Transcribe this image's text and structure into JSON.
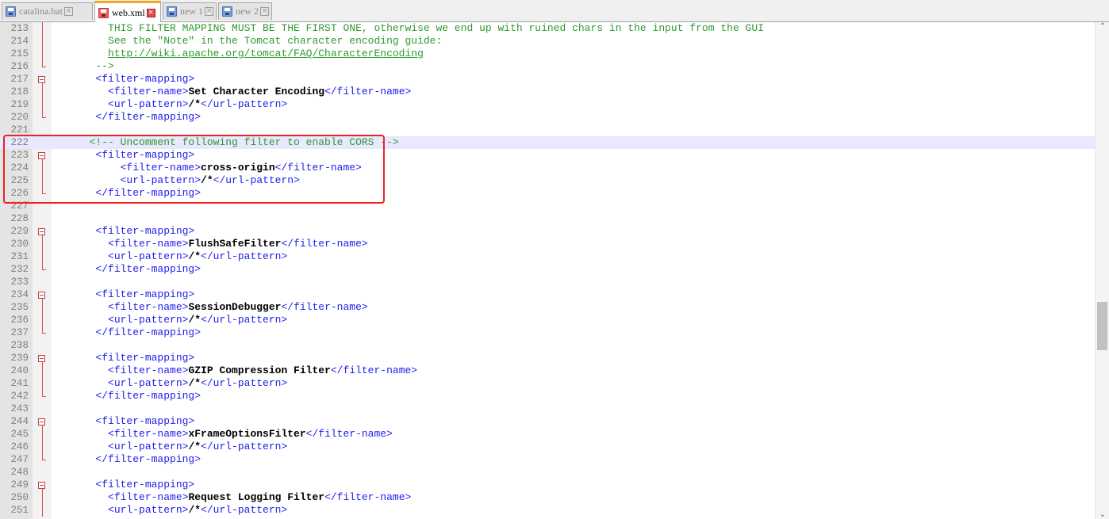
{
  "tabs": [
    {
      "label": "catalina.bat",
      "active": false,
      "icon": "save-disk-icon"
    },
    {
      "label": "web.xml",
      "active": true,
      "icon": "unsaved-disk-icon"
    },
    {
      "label": "new 1",
      "active": false,
      "icon": "save-disk-icon"
    },
    {
      "label": "new 2",
      "active": false,
      "icon": "save-disk-icon"
    }
  ],
  "tab_close_glyph": "×",
  "editor": {
    "lines": [
      {
        "num": "213",
        "segs": [
          {
            "t": "          THIS FILTER MAPPING MUST BE THE FIRST ONE, otherwise we end up with ruined chars in the input from the GUI",
            "c": "cm"
          }
        ]
      },
      {
        "num": "214",
        "segs": [
          {
            "t": "          See the \"Note\" in the Tomcat character encoding guide:",
            "c": "cm"
          }
        ]
      },
      {
        "num": "215",
        "segs": [
          {
            "t": "          ",
            "c": "cm"
          },
          {
            "t": "http://wiki.apache.org/tomcat/FAQ/CharacterEncoding",
            "c": "cm link"
          }
        ]
      },
      {
        "num": "216",
        "segs": [
          {
            "t": "        -->",
            "c": "cm"
          }
        ]
      },
      {
        "num": "217",
        "segs": [
          {
            "t": "        ",
            "c": "tg"
          },
          {
            "t": "<filter-mapping>",
            "c": "tg"
          }
        ]
      },
      {
        "num": "218",
        "segs": [
          {
            "t": "          <filter-name>",
            "c": "tg"
          },
          {
            "t": "Set Character Encoding",
            "c": "tx"
          },
          {
            "t": "</filter-name>",
            "c": "tg"
          }
        ]
      },
      {
        "num": "219",
        "segs": [
          {
            "t": "          <url-pattern>",
            "c": "tg"
          },
          {
            "t": "/*",
            "c": "tx"
          },
          {
            "t": "</url-pattern>",
            "c": "tg"
          }
        ]
      },
      {
        "num": "220",
        "segs": [
          {
            "t": "        </filter-mapping>",
            "c": "tg"
          }
        ]
      },
      {
        "num": "221",
        "segs": []
      },
      {
        "num": "222",
        "segs": [
          {
            "t": "       <!-- Uncomment following filter to enable CORS -->",
            "c": "cm"
          }
        ],
        "highlight": true
      },
      {
        "num": "223",
        "segs": [
          {
            "t": "        <filter-mapping>",
            "c": "tg"
          }
        ]
      },
      {
        "num": "224",
        "segs": [
          {
            "t": "            <filter-name>",
            "c": "tg"
          },
          {
            "t": "cross-origin",
            "c": "tx"
          },
          {
            "t": "</filter-name>",
            "c": "tg"
          }
        ]
      },
      {
        "num": "225",
        "segs": [
          {
            "t": "            <url-pattern>",
            "c": "tg"
          },
          {
            "t": "/*",
            "c": "tx"
          },
          {
            "t": "</url-pattern>",
            "c": "tg"
          }
        ]
      },
      {
        "num": "226",
        "segs": [
          {
            "t": "        </filter-mapping>",
            "c": "tg"
          }
        ]
      },
      {
        "num": "227",
        "segs": []
      },
      {
        "num": "228",
        "segs": []
      },
      {
        "num": "229",
        "segs": [
          {
            "t": "        <filter-mapping>",
            "c": "tg"
          }
        ]
      },
      {
        "num": "230",
        "segs": [
          {
            "t": "          <filter-name>",
            "c": "tg"
          },
          {
            "t": "FlushSafeFilter",
            "c": "tx"
          },
          {
            "t": "</filter-name>",
            "c": "tg"
          }
        ]
      },
      {
        "num": "231",
        "segs": [
          {
            "t": "          <url-pattern>",
            "c": "tg"
          },
          {
            "t": "/*",
            "c": "tx"
          },
          {
            "t": "</url-pattern>",
            "c": "tg"
          }
        ]
      },
      {
        "num": "232",
        "segs": [
          {
            "t": "        </filter-mapping>",
            "c": "tg"
          }
        ]
      },
      {
        "num": "233",
        "segs": []
      },
      {
        "num": "234",
        "segs": [
          {
            "t": "        <filter-mapping>",
            "c": "tg"
          }
        ]
      },
      {
        "num": "235",
        "segs": [
          {
            "t": "          <filter-name>",
            "c": "tg"
          },
          {
            "t": "SessionDebugger",
            "c": "tx"
          },
          {
            "t": "</filter-name>",
            "c": "tg"
          }
        ]
      },
      {
        "num": "236",
        "segs": [
          {
            "t": "          <url-pattern>",
            "c": "tg"
          },
          {
            "t": "/*",
            "c": "tx"
          },
          {
            "t": "</url-pattern>",
            "c": "tg"
          }
        ]
      },
      {
        "num": "237",
        "segs": [
          {
            "t": "        </filter-mapping>",
            "c": "tg"
          }
        ]
      },
      {
        "num": "238",
        "segs": []
      },
      {
        "num": "239",
        "segs": [
          {
            "t": "        <filter-mapping>",
            "c": "tg"
          }
        ]
      },
      {
        "num": "240",
        "segs": [
          {
            "t": "          <filter-name>",
            "c": "tg"
          },
          {
            "t": "GZIP Compression Filter",
            "c": "tx"
          },
          {
            "t": "</filter-name>",
            "c": "tg"
          }
        ]
      },
      {
        "num": "241",
        "segs": [
          {
            "t": "          <url-pattern>",
            "c": "tg"
          },
          {
            "t": "/*",
            "c": "tx"
          },
          {
            "t": "</url-pattern>",
            "c": "tg"
          }
        ]
      },
      {
        "num": "242",
        "segs": [
          {
            "t": "        </filter-mapping>",
            "c": "tg"
          }
        ]
      },
      {
        "num": "243",
        "segs": []
      },
      {
        "num": "244",
        "segs": [
          {
            "t": "        <filter-mapping>",
            "c": "tg"
          }
        ]
      },
      {
        "num": "245",
        "segs": [
          {
            "t": "          <filter-name>",
            "c": "tg"
          },
          {
            "t": "xFrameOptionsFilter",
            "c": "tx"
          },
          {
            "t": "</filter-name>",
            "c": "tg"
          }
        ]
      },
      {
        "num": "246",
        "segs": [
          {
            "t": "          <url-pattern>",
            "c": "tg"
          },
          {
            "t": "/*",
            "c": "tx"
          },
          {
            "t": "</url-pattern>",
            "c": "tg"
          }
        ]
      },
      {
        "num": "247",
        "segs": [
          {
            "t": "        </filter-mapping>",
            "c": "tg"
          }
        ]
      },
      {
        "num": "248",
        "segs": []
      },
      {
        "num": "249",
        "segs": [
          {
            "t": "        <filter-mapping>",
            "c": "tg"
          }
        ]
      },
      {
        "num": "250",
        "segs": [
          {
            "t": "          <filter-name>",
            "c": "tg"
          },
          {
            "t": "Request Logging Filter",
            "c": "tx"
          },
          {
            "t": "</filter-name>",
            "c": "tg"
          }
        ]
      },
      {
        "num": "251",
        "segs": [
          {
            "t": "          <url-pattern>",
            "c": "tg"
          },
          {
            "t": "/*",
            "c": "tx"
          },
          {
            "t": "</url-pattern>",
            "c": "tg"
          }
        ]
      }
    ]
  },
  "scrollbar": {
    "up_arrow": "⌃",
    "down_arrow": "⌄"
  }
}
